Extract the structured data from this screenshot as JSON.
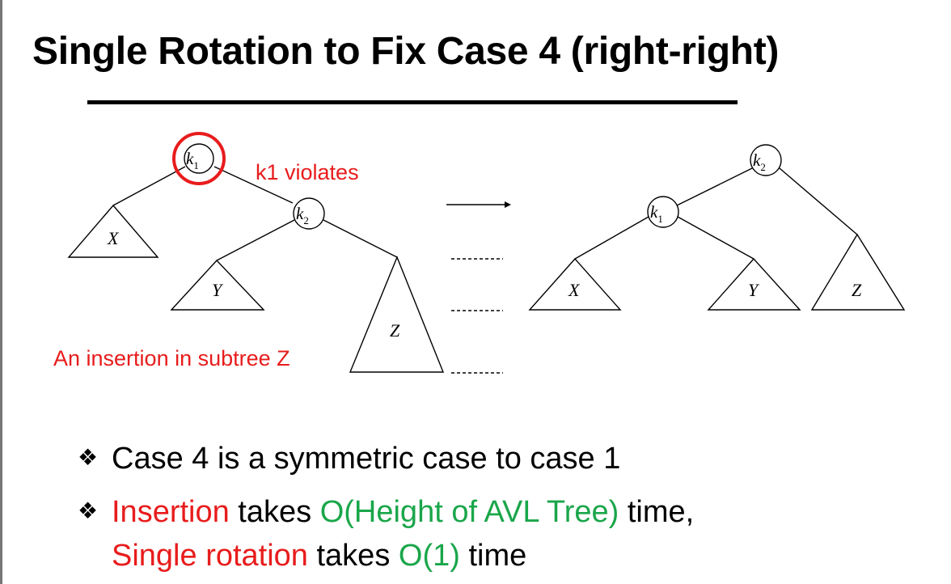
{
  "slide": {
    "title": "Single Rotation to Fix Case 4 (right-right)"
  },
  "diagram": {
    "before": {
      "root_label": "k",
      "root_sub": "1",
      "child_label": "k",
      "child_sub": "2",
      "subtrees": [
        "X",
        "Y",
        "Z"
      ],
      "violation_note": "k1 violates",
      "insertion_note": "An insertion in subtree Z"
    },
    "after": {
      "root_label": "k",
      "root_sub": "2",
      "child_label": "k",
      "child_sub": "1",
      "subtrees": [
        "X",
        "Y",
        "Z"
      ]
    },
    "colors": {
      "highlight": "#e81c1c",
      "line": "#000000"
    }
  },
  "bullets": {
    "marker": "❖",
    "b1": "Case 4 is a symmetric case to case 1",
    "b2_part1": "Insertion",
    "b2_part2": " takes ",
    "b2_part3": "O(Height of AVL Tree)",
    "b2_part4": " time,",
    "b2_line2_part1": "Single rotation",
    "b2_line2_part2": " takes ",
    "b2_line2_part3": "O(1)",
    "b2_line2_part4": " time"
  }
}
